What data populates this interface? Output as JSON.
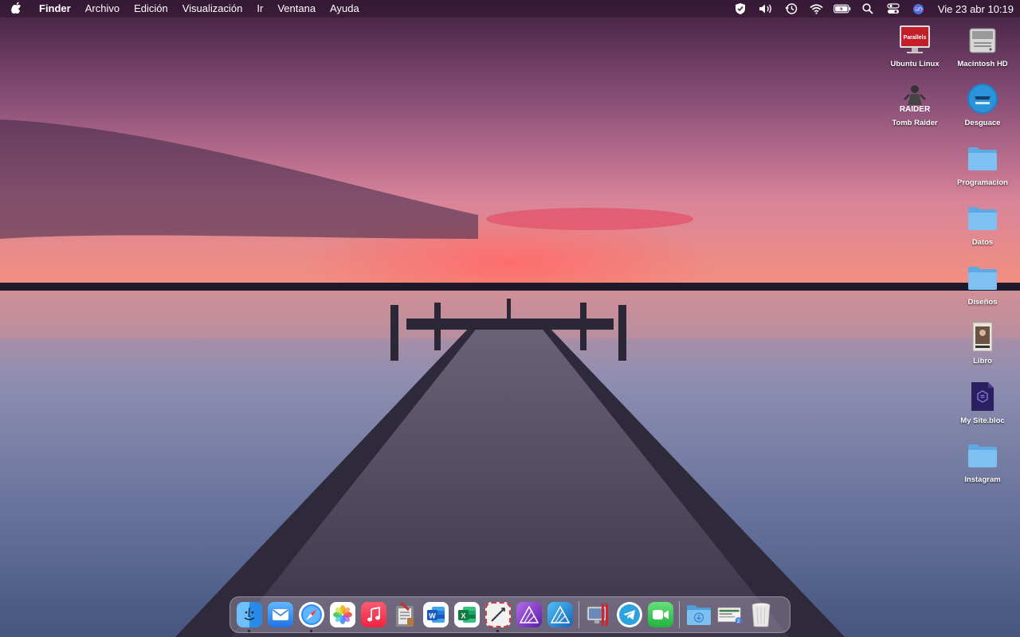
{
  "menubar": {
    "apple_icon": "apple-icon",
    "app_name": "Finder",
    "menus": [
      "Archivo",
      "Edición",
      "Visualización",
      "Ir",
      "Ventana",
      "Ayuda"
    ],
    "status_icons": [
      "shield-icon",
      "volume-icon",
      "time-machine-icon",
      "wifi-icon",
      "battery-icon",
      "search-icon",
      "control-center-icon",
      "siri-icon"
    ],
    "datetime": "Vie 23 abr  10:19"
  },
  "desktop": {
    "items": [
      {
        "label": "Ubuntu Linux",
        "icon": "parallels-vm-icon"
      },
      {
        "label": "Macintosh HD",
        "icon": "hard-drive-icon"
      },
      {
        "label": "Tomb Raider",
        "icon": "tomb-raider-icon",
        "badge": "RAIDER"
      },
      {
        "label": "Desguace",
        "icon": "desguace-icon"
      },
      {
        "label": "Programacion",
        "icon": "folder-icon"
      },
      {
        "label": "Datos",
        "icon": "folder-icon"
      },
      {
        "label": "Diseños",
        "icon": "folder-icon"
      },
      {
        "label": "Libro",
        "icon": "book-icon"
      },
      {
        "label": "My Site.bloc",
        "icon": "bloc-document-icon"
      },
      {
        "label": "Instagram",
        "icon": "folder-icon"
      }
    ],
    "parallels_badge": "Parallels"
  },
  "dock": {
    "apps": [
      {
        "name": "finder-icon",
        "color": "#3a9bf0",
        "running": true
      },
      {
        "name": "mail-icon",
        "color": "#3d8ff0",
        "running": false
      },
      {
        "name": "safari-icon",
        "color": "#2f8ff2",
        "running": true
      },
      {
        "name": "photos-icon",
        "color": "#ffffff",
        "running": false
      },
      {
        "name": "music-icon",
        "color": "#f2354c",
        "running": false
      },
      {
        "name": "script-editor-icon",
        "color": "#9a9a9a",
        "running": false
      },
      {
        "name": "word-icon",
        "color": "#2b5fb4",
        "running": false
      },
      {
        "name": "excel-icon",
        "color": "#1e7a45",
        "running": false
      },
      {
        "name": "airmail-icon",
        "color": "#e8e8e8",
        "running": true
      },
      {
        "name": "affinity-photo-icon",
        "color": "#7c3fc4",
        "running": false
      },
      {
        "name": "affinity-designer-icon",
        "color": "#2c8fe0",
        "running": false
      },
      {
        "name": "parallels-icon",
        "color": "#c8c8c8",
        "running": false
      },
      {
        "name": "telegram-icon",
        "color": "#2aa3e0",
        "running": false
      },
      {
        "name": "facetime-icon",
        "color": "#3dc457",
        "running": false
      },
      {
        "name": "downloads-folder-icon",
        "color": "#5fb1ea",
        "running": false
      },
      {
        "name": "screenshot-stack-icon",
        "color": "#d8d8d8",
        "running": false
      },
      {
        "name": "trash-icon",
        "color": "#e6e6e6",
        "running": false
      }
    ]
  }
}
